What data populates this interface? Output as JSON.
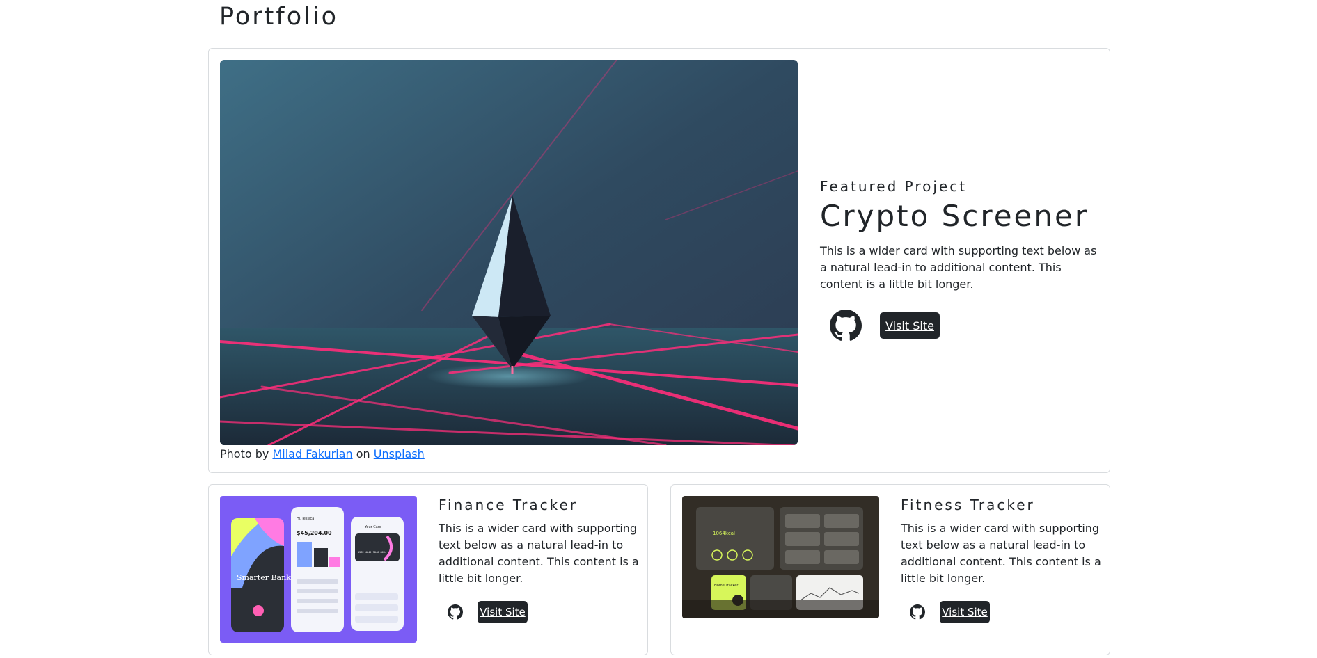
{
  "page": {
    "title": "Portfolio"
  },
  "featured": {
    "eyebrow": "Featured Project",
    "title": "Crypto Screener",
    "description": "This is a wider card with supporting text below as a natural lead-in to additional content. This content is a little bit longer.",
    "visit_label": "Visit Site",
    "github_icon": "github-icon",
    "credit": {
      "prefix": "Photo by",
      "author": "Milad Fakurian",
      "middle": "on",
      "source": "Unsplash"
    }
  },
  "cards": [
    {
      "title": "Finance Tracker",
      "description": "This is a wider card with supporting text below as a natural lead-in to additional content. This content is a little bit longer.",
      "visit_label": "Visit Site",
      "github_icon": "github-icon",
      "thumb": {
        "headline": "Smarter Banking.",
        "balance": "$45,204.00",
        "greeting": "Hi, Jessica!",
        "card_label": "Your Card",
        "card_number": "5532 4642 9846 8694"
      }
    },
    {
      "title": "Fitness Tracker",
      "description": "This is a wider card with supporting text below as a natural lead-in to additional content. This content is a little bit longer.",
      "visit_label": "Visit Site",
      "github_icon": "github-icon",
      "thumb": {
        "kcal": "1064kcal",
        "label": "Home Tracker"
      }
    }
  ],
  "colors": {
    "dark": "#212529",
    "link": "#0d6efd",
    "border": "#d9dcdf",
    "neon": "#ff2d7a",
    "finance_bg": "#7b5cf5",
    "fitness_accent": "#d7f65a"
  }
}
